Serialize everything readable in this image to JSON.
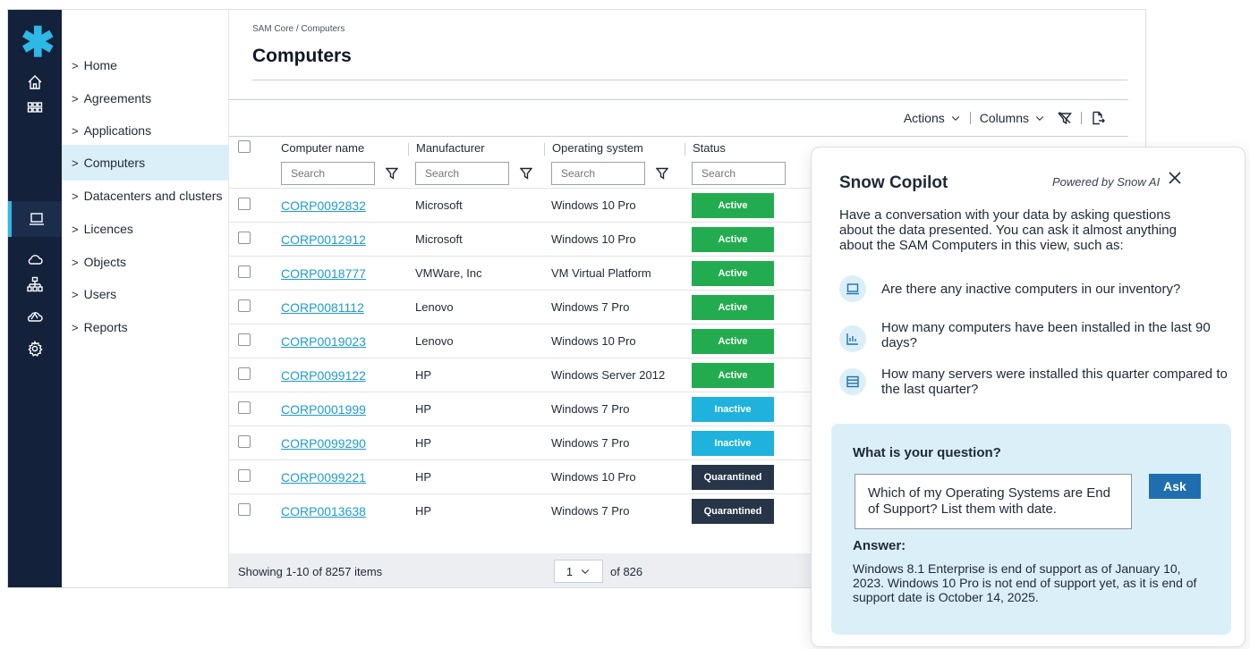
{
  "nav": {
    "items": [
      {
        "label": "Home"
      },
      {
        "label": "Agreements"
      },
      {
        "label": "Applications"
      },
      {
        "label": "Computers"
      },
      {
        "label": "Datacenters and clusters"
      },
      {
        "label": "Licences"
      },
      {
        "label": "Objects"
      },
      {
        "label": "Users"
      },
      {
        "label": "Reports"
      }
    ],
    "chevron": ">",
    "active": "Computers"
  },
  "rail": {
    "icons": [
      "asterisk-logo",
      "home-icon",
      "apps-grid-icon",
      "computer-icon",
      "cloud-icon",
      "network-icon",
      "saas-cloud-icon",
      "settings-icon"
    ],
    "accent": "#2db8e6",
    "background": "#13213b"
  },
  "header": {
    "breadcrumb": "SAM Core / Computers",
    "title": "Computers"
  },
  "toolbar": {
    "actions": "Actions",
    "columns": "Columns"
  },
  "table": {
    "columns": [
      "Computer name",
      "Manufacturer",
      "Operating system",
      "Status"
    ],
    "search_placeholder": "Search",
    "rows": [
      {
        "name": "CORP0092832",
        "manufacturer": "Microsoft",
        "os": "Windows 10 Pro",
        "status": "Active"
      },
      {
        "name": "CORP0012912",
        "manufacturer": "Microsoft",
        "os": "Windows 10 Pro",
        "status": "Active"
      },
      {
        "name": "CORP0018777",
        "manufacturer": "VMWare, Inc",
        "os": "VM Virtual Platform",
        "status": "Active"
      },
      {
        "name": "CORP0081112",
        "manufacturer": "Lenovo",
        "os": "Windows 7 Pro",
        "status": "Active"
      },
      {
        "name": "CORP0019023",
        "manufacturer": "Lenovo",
        "os": "Windows 10 Pro",
        "status": "Active"
      },
      {
        "name": "CORP0099122",
        "manufacturer": "HP",
        "os": "Windows Server 2012",
        "status": "Active"
      },
      {
        "name": "CORP0001999",
        "manufacturer": "HP",
        "os": "Windows 7 Pro",
        "status": "Inactive"
      },
      {
        "name": "CORP0099290",
        "manufacturer": "HP",
        "os": "Windows 7 Pro",
        "status": "Inactive"
      },
      {
        "name": "CORP0099221",
        "manufacturer": "HP",
        "os": "Windows 10 Pro",
        "status": "Quarantined"
      },
      {
        "name": "CORP0013638",
        "manufacturer": "HP",
        "os": "Windows 7 Pro",
        "status": "Quarantined"
      }
    ],
    "status_colors": {
      "Active": "#23ac4f",
      "Inactive": "#1fb2dd",
      "Quarantined": "#263548"
    }
  },
  "footer": {
    "showing": "Showing 1-10 of 8257 items",
    "page": "1",
    "of_pages": "of 826"
  },
  "copilot": {
    "title": "Snow Copilot",
    "powered_by": "Powered by Snow AI",
    "intro": "Have a conversation with your data by asking questions about the data presented. You can ask it almost anything about the SAM Computers in this view, such as:",
    "suggestions": [
      {
        "icon": "computer-icon",
        "text": "Are there any inactive computers in our inventory?"
      },
      {
        "icon": "bar-chart-icon",
        "text": "How many computers have been installed in the last 90 days?"
      },
      {
        "icon": "server-icon",
        "text": "How many servers were installed this quarter compared to the last quarter?"
      }
    ],
    "question_label": "What is your question?",
    "question_value": "Which of my Operating Systems are End of Support? List them with date.",
    "ask_label": "Ask",
    "answer_label": "Answer:",
    "answer_text": "Windows 8.1 Enterprise is end of support as of January 10, 2023. Windows 10 Pro is not end of support yet, as it is end of support date is October 14, 2025."
  }
}
